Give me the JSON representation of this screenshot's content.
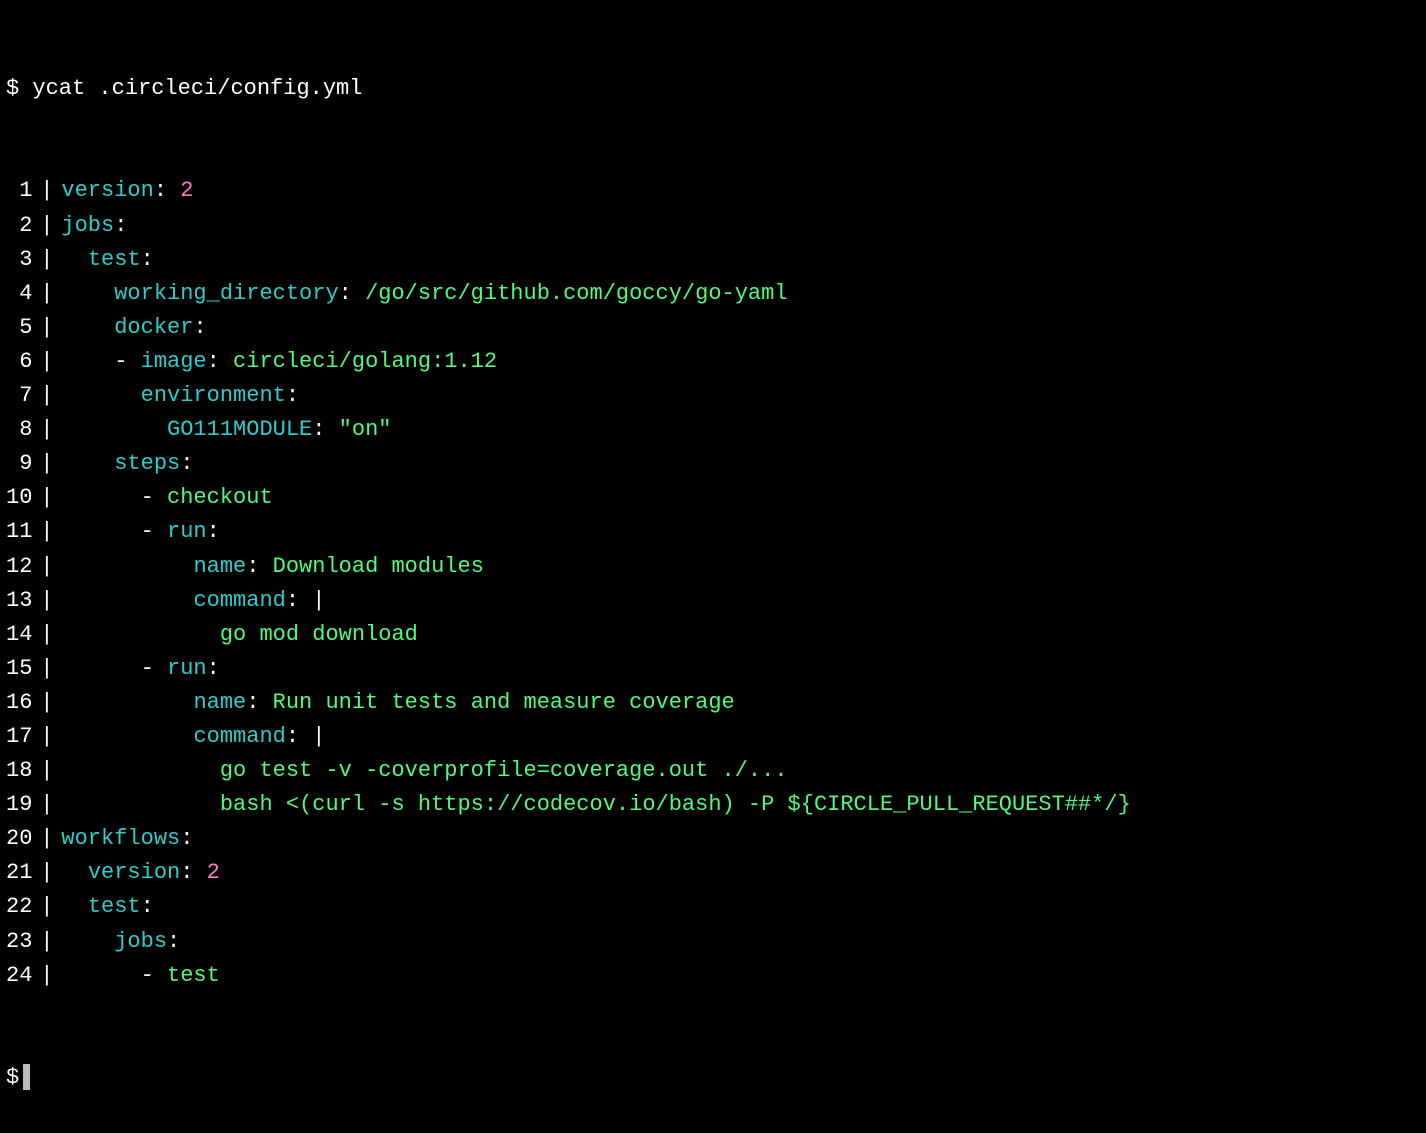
{
  "prompt": {
    "symbol": "$",
    "command": "ycat .circleci/config.yml"
  },
  "colors": {
    "key": "#2dcccd",
    "number": "#ff79c6",
    "string": "#50fa7b",
    "plain": "#f8f8f2",
    "bg": "#000000"
  },
  "lines": [
    {
      "n": 1,
      "indent": "",
      "tokens": [
        {
          "t": "version",
          "c": "key"
        },
        {
          "t": ": ",
          "c": "plain"
        },
        {
          "t": "2",
          "c": "number"
        }
      ]
    },
    {
      "n": 2,
      "indent": "",
      "tokens": [
        {
          "t": "jobs",
          "c": "key"
        },
        {
          "t": ":",
          "c": "plain"
        }
      ]
    },
    {
      "n": 3,
      "indent": "  ",
      "tokens": [
        {
          "t": "test",
          "c": "key"
        },
        {
          "t": ":",
          "c": "plain"
        }
      ]
    },
    {
      "n": 4,
      "indent": "    ",
      "tokens": [
        {
          "t": "working_directory",
          "c": "key"
        },
        {
          "t": ": ",
          "c": "plain"
        },
        {
          "t": "/go/src/github.com/goccy/go-yaml",
          "c": "string"
        }
      ]
    },
    {
      "n": 5,
      "indent": "    ",
      "tokens": [
        {
          "t": "docker",
          "c": "key"
        },
        {
          "t": ":",
          "c": "plain"
        }
      ]
    },
    {
      "n": 6,
      "indent": "    ",
      "tokens": [
        {
          "t": "- ",
          "c": "plain"
        },
        {
          "t": "image",
          "c": "key"
        },
        {
          "t": ": ",
          "c": "plain"
        },
        {
          "t": "circleci/golang:1.12",
          "c": "string"
        }
      ]
    },
    {
      "n": 7,
      "indent": "      ",
      "tokens": [
        {
          "t": "environment",
          "c": "key"
        },
        {
          "t": ":",
          "c": "plain"
        }
      ]
    },
    {
      "n": 8,
      "indent": "        ",
      "tokens": [
        {
          "t": "GO111MODULE",
          "c": "key"
        },
        {
          "t": ": ",
          "c": "plain"
        },
        {
          "t": "\"on\"",
          "c": "string"
        }
      ]
    },
    {
      "n": 9,
      "indent": "    ",
      "tokens": [
        {
          "t": "steps",
          "c": "key"
        },
        {
          "t": ":",
          "c": "plain"
        }
      ]
    },
    {
      "n": 10,
      "indent": "      ",
      "tokens": [
        {
          "t": "- ",
          "c": "plain"
        },
        {
          "t": "checkout",
          "c": "string"
        }
      ]
    },
    {
      "n": 11,
      "indent": "      ",
      "tokens": [
        {
          "t": "- ",
          "c": "plain"
        },
        {
          "t": "run",
          "c": "key"
        },
        {
          "t": ":",
          "c": "plain"
        }
      ]
    },
    {
      "n": 12,
      "indent": "          ",
      "tokens": [
        {
          "t": "name",
          "c": "key"
        },
        {
          "t": ": ",
          "c": "plain"
        },
        {
          "t": "Download modules",
          "c": "string"
        }
      ]
    },
    {
      "n": 13,
      "indent": "          ",
      "tokens": [
        {
          "t": "command",
          "c": "key"
        },
        {
          "t": ": ",
          "c": "plain"
        },
        {
          "t": "|",
          "c": "plain"
        }
      ]
    },
    {
      "n": 14,
      "indent": "            ",
      "tokens": [
        {
          "t": "go mod download",
          "c": "string"
        }
      ]
    },
    {
      "n": 15,
      "indent": "      ",
      "tokens": [
        {
          "t": "- ",
          "c": "plain"
        },
        {
          "t": "run",
          "c": "key"
        },
        {
          "t": ":",
          "c": "plain"
        }
      ]
    },
    {
      "n": 16,
      "indent": "          ",
      "tokens": [
        {
          "t": "name",
          "c": "key"
        },
        {
          "t": ": ",
          "c": "plain"
        },
        {
          "t": "Run unit tests and measure coverage",
          "c": "string"
        }
      ]
    },
    {
      "n": 17,
      "indent": "          ",
      "tokens": [
        {
          "t": "command",
          "c": "key"
        },
        {
          "t": ": ",
          "c": "plain"
        },
        {
          "t": "|",
          "c": "plain"
        }
      ]
    },
    {
      "n": 18,
      "indent": "            ",
      "tokens": [
        {
          "t": "go test -v -coverprofile=coverage.out ./...",
          "c": "string"
        }
      ]
    },
    {
      "n": 19,
      "indent": "            ",
      "tokens": [
        {
          "t": "bash <(curl -s https://codecov.io/bash) -P ${CIRCLE_PULL_REQUEST##*/}",
          "c": "string"
        }
      ]
    },
    {
      "n": 20,
      "indent": "",
      "tokens": [
        {
          "t": "workflows",
          "c": "key"
        },
        {
          "t": ":",
          "c": "plain"
        }
      ]
    },
    {
      "n": 21,
      "indent": "  ",
      "tokens": [
        {
          "t": "version",
          "c": "key"
        },
        {
          "t": ": ",
          "c": "plain"
        },
        {
          "t": "2",
          "c": "number"
        }
      ]
    },
    {
      "n": 22,
      "indent": "  ",
      "tokens": [
        {
          "t": "test",
          "c": "key"
        },
        {
          "t": ":",
          "c": "plain"
        }
      ]
    },
    {
      "n": 23,
      "indent": "    ",
      "tokens": [
        {
          "t": "jobs",
          "c": "key"
        },
        {
          "t": ":",
          "c": "plain"
        }
      ]
    },
    {
      "n": 24,
      "indent": "      ",
      "tokens": [
        {
          "t": "- ",
          "c": "plain"
        },
        {
          "t": "test",
          "c": "string"
        }
      ]
    }
  ],
  "end_prompt": "$"
}
